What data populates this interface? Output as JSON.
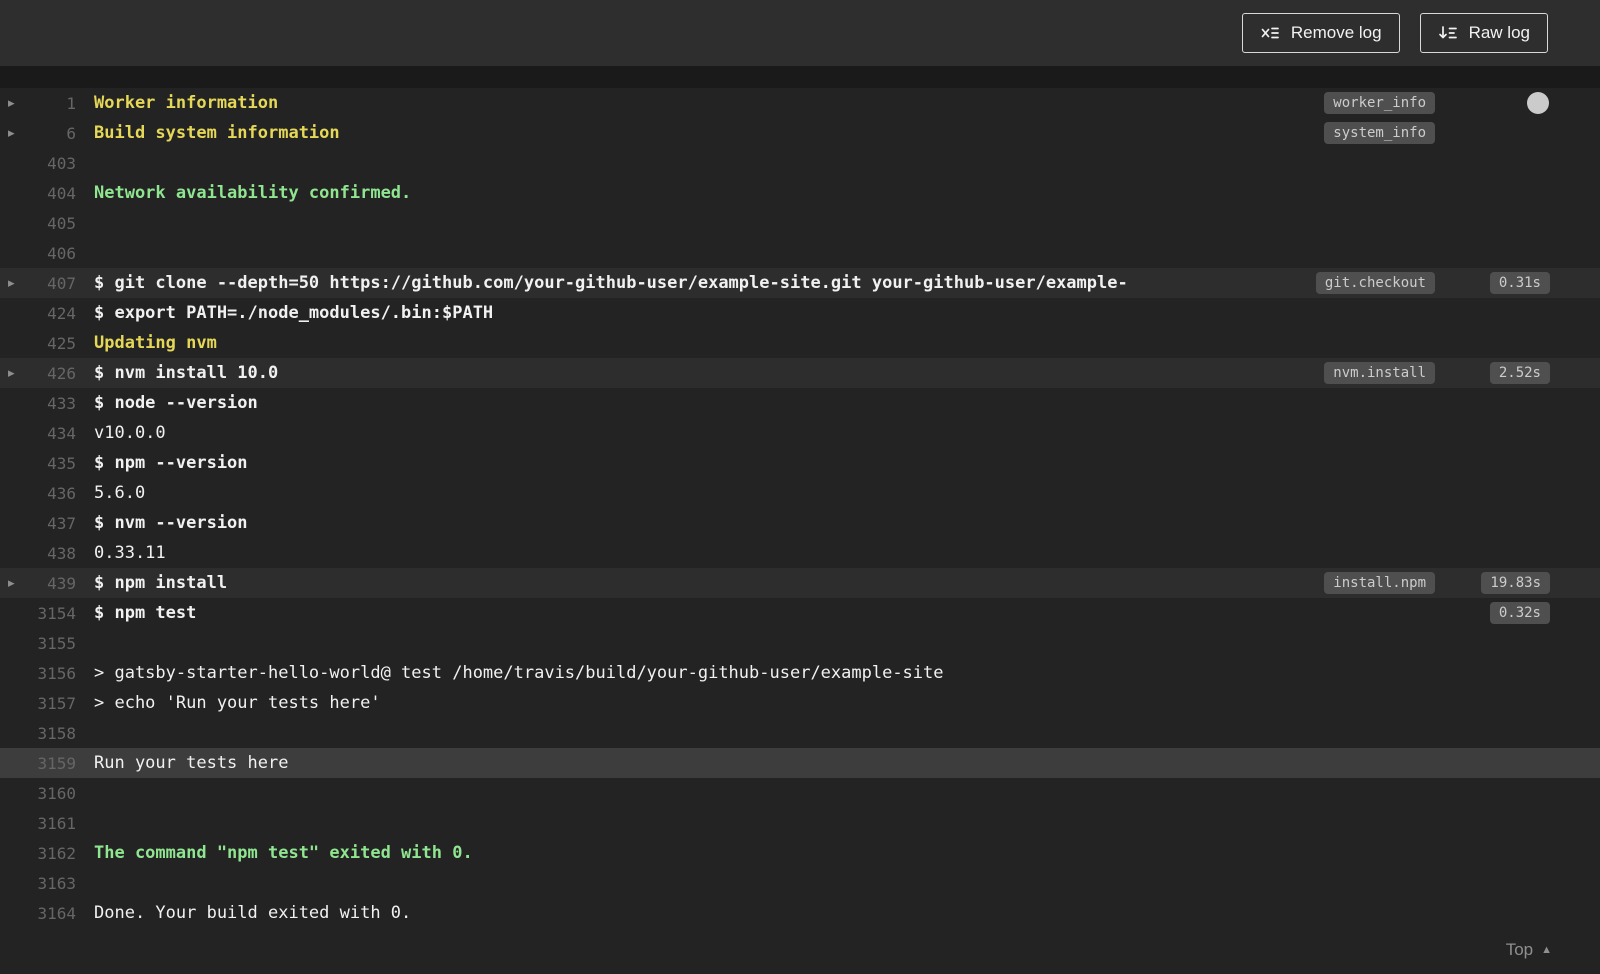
{
  "header": {
    "buttons": [
      {
        "label": "Remove log",
        "icon": "remove-log-icon"
      },
      {
        "label": "Raw log",
        "icon": "raw-log-icon"
      }
    ]
  },
  "log": {
    "lines": [
      {
        "num": "1",
        "text": "Worker information",
        "style": "yellow",
        "fold": true,
        "badge": "worker_info"
      },
      {
        "num": "6",
        "text": "Build system information",
        "style": "yellow",
        "fold": true,
        "badge": "system_info"
      },
      {
        "num": "403",
        "text": ""
      },
      {
        "num": "404",
        "text": "Network availability confirmed.",
        "style": "green"
      },
      {
        "num": "405",
        "text": ""
      },
      {
        "num": "406",
        "text": ""
      },
      {
        "num": "407",
        "text": "$ git clone --depth=50 https://github.com/your-github-user/example-site.git your-github-user/example-",
        "style": "command",
        "fold": true,
        "badge": "git.checkout",
        "time": "0.31s",
        "highlight": "soft"
      },
      {
        "num": "424",
        "text": "$ export PATH=./node_modules/.bin:$PATH",
        "style": "command"
      },
      {
        "num": "425",
        "text": "Updating nvm",
        "style": "yellow"
      },
      {
        "num": "426",
        "text": "$ nvm install 10.0",
        "style": "command",
        "fold": true,
        "badge": "nvm.install",
        "time": "2.52s",
        "highlight": "soft"
      },
      {
        "num": "433",
        "text": "$ node --version",
        "style": "command"
      },
      {
        "num": "434",
        "text": "v10.0.0"
      },
      {
        "num": "435",
        "text": "$ npm --version",
        "style": "command"
      },
      {
        "num": "436",
        "text": "5.6.0"
      },
      {
        "num": "437",
        "text": "$ nvm --version",
        "style": "command"
      },
      {
        "num": "438",
        "text": "0.33.11"
      },
      {
        "num": "439",
        "text": "$ npm install",
        "style": "command",
        "fold": true,
        "badge": "install.npm",
        "time": "19.83s",
        "highlight": "soft"
      },
      {
        "num": "3154",
        "text": "$ npm test",
        "style": "command",
        "time": "0.32s"
      },
      {
        "num": "3155",
        "text": ""
      },
      {
        "num": "3156",
        "text": "> gatsby-starter-hello-world@ test /home/travis/build/your-github-user/example-site"
      },
      {
        "num": "3157",
        "text": "> echo 'Run your tests here'"
      },
      {
        "num": "3158",
        "text": ""
      },
      {
        "num": "3159",
        "text": "Run your tests here",
        "highlight": "strong"
      },
      {
        "num": "3160",
        "text": ""
      },
      {
        "num": "3161",
        "text": ""
      },
      {
        "num": "3162",
        "text": "The command \"npm test\" exited with 0.",
        "style": "green"
      },
      {
        "num": "3163",
        "text": ""
      },
      {
        "num": "3164",
        "text": "Done. Your build exited with 0."
      }
    ]
  },
  "footer": {
    "top_label": "Top"
  },
  "colors": {
    "header_bg": "#2e2e2e",
    "log_bg": "#232323",
    "page_bg": "#1a1a1a",
    "text": "#f1f1f1",
    "yellow": "#e5d757",
    "green": "#90e590",
    "line_number": "#666666",
    "badge_bg": "#4f4f4f",
    "badge_text": "#cccccc",
    "row_highlight_soft": "#2d2d2d",
    "row_highlight_strong": "#3d3d3d"
  }
}
